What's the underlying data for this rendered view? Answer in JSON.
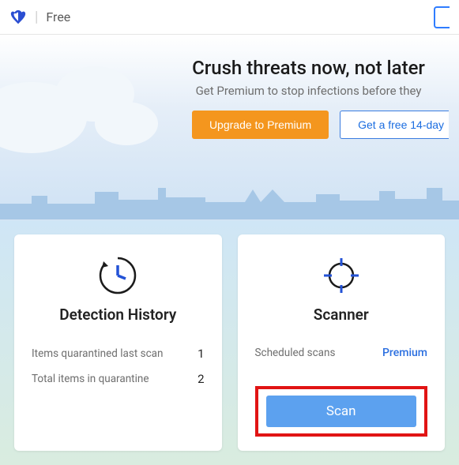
{
  "header": {
    "tier": "Free"
  },
  "hero": {
    "title": "Crush threats now, not later",
    "subtitle": "Get Premium to stop infections before they",
    "upgrade_label": "Upgrade to Premium",
    "trial_label": "Get a free 14-day"
  },
  "cards": {
    "history": {
      "title": "Detection History",
      "stat1_label": "Items quarantined last scan",
      "stat1_value": "1",
      "stat2_label": "Total items in quarantine",
      "stat2_value": "2"
    },
    "scanner": {
      "title": "Scanner",
      "scheduled_label": "Scheduled scans",
      "scheduled_value": "Premium",
      "scan_label": "Scan"
    }
  }
}
